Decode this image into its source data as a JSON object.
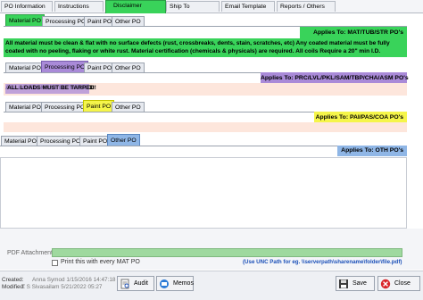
{
  "top_tabs": [
    "PO Information",
    "Instructions",
    "Disclaimer",
    "Ship To",
    "Email Template",
    "Reports / Others"
  ],
  "section1": {
    "tabs": [
      "Material PO",
      "Processing PO",
      "Paint PO",
      "Other PO"
    ],
    "applies_to": "Applies To: MAT/TUB/STR PO's",
    "message": "All material must be clean & flat with no surface defects (rust, crossbreaks, dents, stain, scratches, etc) Any coated material must be fully coated with no peeling, flaking or white rust.  Material certification (chemicals & physicals) are required.  All coils Require a 20\" min I.D."
  },
  "section2": {
    "tabs": [
      "Material PO",
      "Processing PO",
      "Paint PO",
      "Other PO"
    ],
    "applies_to": "Applies To: PRC/LVL/PKL/SAM/TBP/CHA/ASM PO's",
    "message": "ALL LOADS MUST BE TARPED!"
  },
  "section3": {
    "tabs": [
      "Material PO",
      "Processing PO",
      "Paint PO",
      "Other PO"
    ],
    "applies_to": "Applies To: PAI/PAS/COA PO's",
    "message": ""
  },
  "section4": {
    "tabs": [
      "Material PO",
      "Processing PO",
      "Paint PO",
      "Other PO"
    ],
    "applies_to": "Applies To: OTH PO's",
    "message": ""
  },
  "attachment": {
    "label": "PDF Attachment:",
    "value": "",
    "checkbox_label": "Print this with every MAT PO",
    "hint": "(Use UNC Path for eg. \\\\serverpath\\sharename\\folder\\file.pdf)"
  },
  "footer": {
    "created_label": "Created:",
    "created_value": "Anna Symod 1/15/2016 14:47:18",
    "modified_label": "Modified:",
    "modified_value": "T S Sivasailam 5/21/2022 05:27",
    "audit_label": "Audit",
    "memos_label": "Memos",
    "save_label": "Save",
    "close_label": "Close"
  },
  "colors": {
    "green": "#39d35a",
    "purple": "#a98ad8",
    "yellow": "#f5f54a",
    "blue": "#8fb6e6",
    "peach": "#fde6dc",
    "hint_blue": "#1a4fb8"
  }
}
